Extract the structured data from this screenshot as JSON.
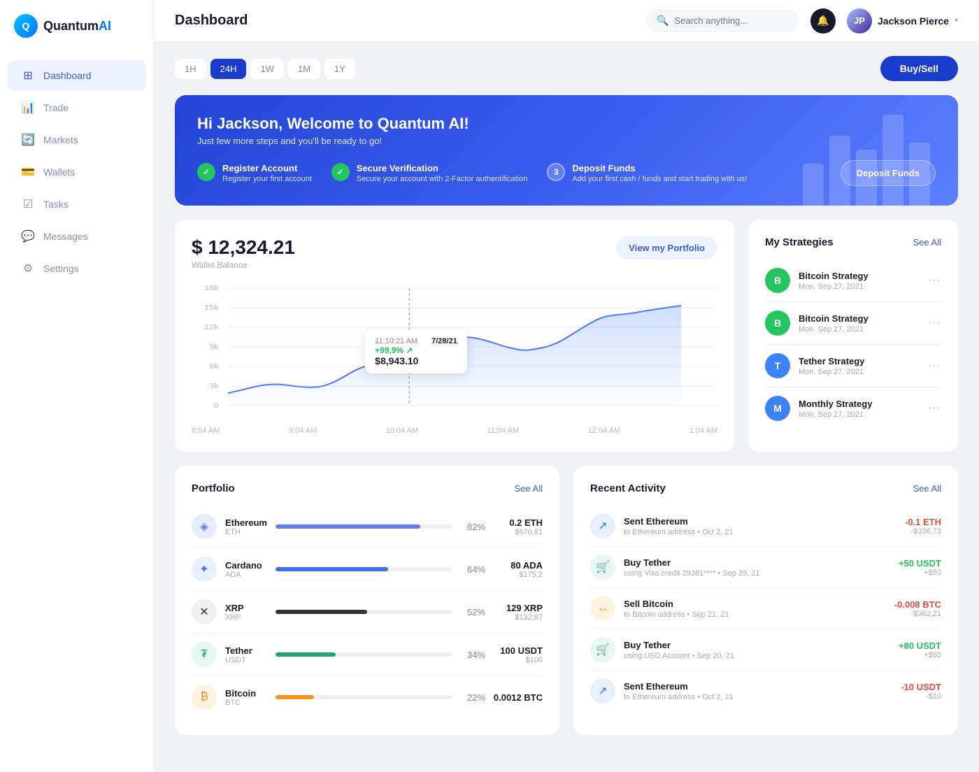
{
  "logo": {
    "text": "Quantum",
    "highlight": "AI",
    "icon": "Q"
  },
  "sidebar": {
    "items": [
      {
        "id": "dashboard",
        "label": "Dashboard",
        "icon": "⊞",
        "active": true
      },
      {
        "id": "trade",
        "label": "Trade",
        "icon": "📊"
      },
      {
        "id": "markets",
        "label": "Markets",
        "icon": "🔄"
      },
      {
        "id": "wallets",
        "label": "Wallets",
        "icon": "💳"
      },
      {
        "id": "tasks",
        "label": "Tasks",
        "icon": "☑"
      },
      {
        "id": "messages",
        "label": "Messages",
        "icon": "💬"
      },
      {
        "id": "settings",
        "label": "Settings",
        "icon": "⚙"
      }
    ]
  },
  "header": {
    "title": "Dashboard",
    "search": {
      "placeholder": "Search anything..."
    },
    "user": {
      "name": "Jackson Pierce",
      "initials": "JP"
    }
  },
  "timeFilters": [
    "1H",
    "24H",
    "1W",
    "1M",
    "1Y"
  ],
  "activeFilter": "24H",
  "buySellLabel": "Buy/Sell",
  "banner": {
    "title": "Hi Jackson, Welcome to Quantum AI!",
    "subtitle": "Just few more steps and you'll be ready to go!",
    "steps": [
      {
        "num": "✓",
        "label": "Register Account",
        "desc": "Register your first account",
        "done": true
      },
      {
        "num": "✓",
        "label": "Secure Verification",
        "desc": "Secure your account with 2-Factor authentification",
        "done": true
      },
      {
        "num": "3",
        "label": "Deposit Funds",
        "desc": "Add your first cash / funds and start trading with us!",
        "done": false
      }
    ],
    "depositBtn": "Deposit Funds"
  },
  "wallet": {
    "balance": "$ 12,324.21",
    "label": "Wallet Balance",
    "viewBtn": "View my Portfolio"
  },
  "chart": {
    "xLabels": [
      "8:04 AM",
      "9:04 AM",
      "10:04 AM",
      "11:04 AM",
      "12:04 AM",
      "1:04 AM"
    ],
    "yLabels": [
      "18k",
      "15k",
      "12k",
      "9k",
      "6k",
      "3k",
      "0"
    ],
    "tooltip": {
      "time": "11:10:21 AM",
      "date": "7/28/21",
      "change": "+99,9% ↗",
      "value": "$8,943.10"
    }
  },
  "strategies": {
    "title": "My Strategies",
    "seeAll": "See All",
    "items": [
      {
        "initial": "B",
        "name": "Bitcoin Strategy",
        "date": "Mon. Sep 27, 2021",
        "color": "green"
      },
      {
        "initial": "B",
        "name": "Bitcoin Strategy",
        "date": "Mon. Sep 27, 2021",
        "color": "green"
      },
      {
        "initial": "T",
        "name": "Tether Strategy",
        "date": "Mon. Sep 27, 2021",
        "color": "blue"
      },
      {
        "initial": "M",
        "name": "Monthly Strategy",
        "date": "Mon. Sep 27, 2021",
        "color": "blue"
      }
    ]
  },
  "portfolio": {
    "title": "Portfolio",
    "seeAll": "See All",
    "items": [
      {
        "name": "Ethereum",
        "ticker": "ETH",
        "pct": 82,
        "color": "#627eea",
        "amount": "0.2 ETH",
        "value": "$670,61",
        "iconClass": "coin-eth",
        "icon": "◈"
      },
      {
        "name": "Cardano",
        "ticker": "ADA",
        "pct": 64,
        "color": "#3b6efb",
        "amount": "80 ADA",
        "value": "$175,2",
        "iconClass": "coin-ada",
        "icon": "✦"
      },
      {
        "name": "XRP",
        "ticker": "XRP",
        "pct": 52,
        "color": "#333",
        "amount": "129 XRP",
        "value": "$132,87",
        "iconClass": "coin-xrp",
        "icon": "✕"
      },
      {
        "name": "Tether",
        "ticker": "USDT",
        "pct": 34,
        "color": "#26a17b",
        "amount": "100 USDT",
        "value": "$100",
        "iconClass": "coin-usdt",
        "icon": "₮"
      },
      {
        "name": "Bitcoin",
        "ticker": "BTC",
        "pct": 22,
        "color": "#f7931a",
        "amount": "0.0012 BTC",
        "value": "",
        "iconClass": "coin-btc",
        "icon": "₿"
      }
    ]
  },
  "activity": {
    "title": "Recent Activity",
    "seeAll": "See All",
    "items": [
      {
        "name": "Sent Ethereum",
        "sub": "to Ethereum address • Oct 2, 21",
        "amountMain": "-0.1 ETH",
        "amountSub": "-$336,73",
        "positive": false,
        "iconClass": "act-blue",
        "icon": "↗"
      },
      {
        "name": "Buy Tether",
        "sub": "using Visa credit 29381**** • Sep 29, 21",
        "amountMain": "+50 USDT",
        "amountSub": "+$50",
        "positive": true,
        "iconClass": "act-green",
        "icon": "🛒"
      },
      {
        "name": "Sell Bitcoin",
        "sub": "to Bitcoin address • Sep 21, 21",
        "amountMain": "-0.008 BTC",
        "amountSub": "-$382,21",
        "positive": false,
        "iconClass": "act-orange",
        "icon": "↔"
      },
      {
        "name": "Buy Tether",
        "sub": "using USD Account • Sep 20, 21",
        "amountMain": "+80 USDT",
        "amountSub": "+$80",
        "positive": true,
        "iconClass": "act-green",
        "icon": "🛒"
      },
      {
        "name": "Sent Ethereum",
        "sub": "to Ethereum address • Oct 2, 21",
        "amountMain": "-10 USDT",
        "amountSub": "-$10",
        "positive": false,
        "iconClass": "act-blue",
        "icon": "↗"
      }
    ]
  }
}
